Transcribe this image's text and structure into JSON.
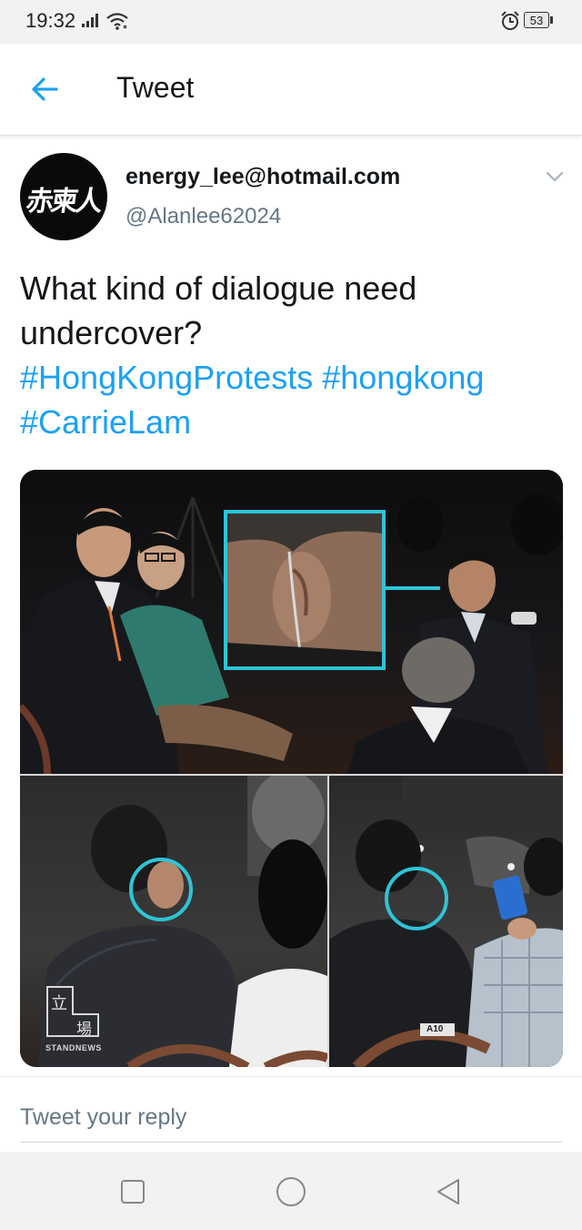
{
  "status_bar": {
    "time": "19:32",
    "battery": "53"
  },
  "header": {
    "title": "Tweet"
  },
  "tweet": {
    "avatar_text": "赤柬人",
    "display_name": "energy_lee@hotmail.com",
    "handle": "@Alanlee62024",
    "text_lines": [
      "What kind of dialogue need",
      "undercover?"
    ],
    "hashtags": [
      "#HongKongProtests",
      "#hongkong",
      "#CarrieLam"
    ]
  },
  "media": {
    "watermark_glyphs": [
      "立",
      "場"
    ],
    "watermark_label": "STANDNEWS",
    "seat_label": "A10",
    "highlight_color": "#2ec4d6"
  },
  "reply": {
    "placeholder": "Tweet your reply"
  },
  "colors": {
    "accent": "#1da1f2",
    "text": "#14171a",
    "secondary": "#657786"
  },
  "nav": {
    "icons": [
      "recents-square-icon",
      "home-circle-icon",
      "back-triangle-icon"
    ]
  }
}
